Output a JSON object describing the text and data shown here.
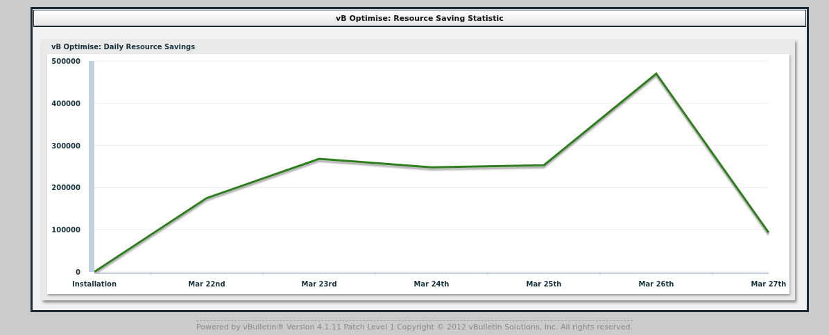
{
  "window": {
    "title": "vB Optimise: Resource Saving Statistic"
  },
  "card": {
    "title": "vB Optimise: Daily Resource Savings",
    "chart_data": {
      "type": "line",
      "categories": [
        "Installation",
        "Mar 22nd",
        "Mar 23rd",
        "Mar 24th",
        "Mar 25th",
        "Mar 26th",
        "Mar 27th"
      ],
      "series": [
        {
          "color": "#2e7d1e",
          "values": [
            0,
            175000,
            268000,
            248000,
            253000,
            470000,
            93000
          ]
        }
      ],
      "grid": true,
      "ylim": [
        0,
        500000
      ],
      "yticks": [
        0,
        100000,
        200000,
        300000,
        400000,
        500000
      ]
    }
  },
  "footer": "Powered by vBulletin® Version 4.1.11 Patch Level 1 Copyright © 2012 vBulletin Solutions, Inc. All rights reserved."
}
